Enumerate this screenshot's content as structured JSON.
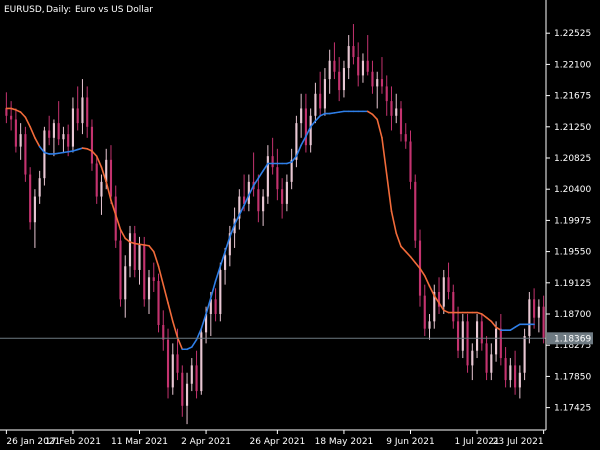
{
  "chart_data": {
    "type": "candlestick",
    "symbol": "EURUSD",
    "timeframe": "Daily",
    "description": "Euro vs US Dollar",
    "current_price": "1.18369",
    "ylim": [
      1.1712,
      1.2295
    ],
    "y_ticks": [
      "1.22525",
      "1.22100",
      "1.21675",
      "1.21250",
      "1.20825",
      "1.20400",
      "1.19975",
      "1.19550",
      "1.19125",
      "1.18700",
      "1.18275",
      "1.17850",
      "1.17425"
    ],
    "x_ticks": [
      "26 Jan 2021",
      "17 Feb 2021",
      "11 Mar 2021",
      "2 Apr 2021",
      "26 Apr 2021",
      "18 May 2021",
      "9 Jun 2021",
      "1 Jul 2021",
      "23 Jul 2021"
    ],
    "candles": [
      [
        1.215,
        1.2172,
        1.213,
        1.214
      ],
      [
        1.214,
        1.216,
        1.212,
        1.2135
      ],
      [
        1.2135,
        1.215,
        1.209,
        1.2098
      ],
      [
        1.2098,
        1.213,
        1.208,
        1.2115
      ],
      [
        1.2115,
        1.2125,
        1.205,
        1.206
      ],
      [
        1.206,
        1.207,
        1.1985,
        1.1995
      ],
      [
        1.1995,
        1.204,
        1.196,
        1.203
      ],
      [
        1.203,
        1.2065,
        1.202,
        1.2055
      ],
      [
        1.2055,
        1.2125,
        1.2045,
        1.212
      ],
      [
        1.212,
        1.214,
        1.21,
        1.211
      ],
      [
        1.211,
        1.2135,
        1.2085,
        1.213
      ],
      [
        1.213,
        1.216,
        1.21,
        1.2108
      ],
      [
        1.2108,
        1.2125,
        1.209,
        1.2115
      ],
      [
        1.2115,
        1.2128,
        1.2085,
        1.2098
      ],
      [
        1.2098,
        1.2165,
        1.209,
        1.215
      ],
      [
        1.215,
        1.218,
        1.212,
        1.213
      ],
      [
        1.213,
        1.219,
        1.2115,
        1.2165
      ],
      [
        1.2165,
        1.218,
        1.211,
        1.2125
      ],
      [
        1.2125,
        1.2135,
        1.2065,
        1.2075
      ],
      [
        1.2075,
        1.2085,
        1.202,
        1.203
      ],
      [
        1.203,
        1.206,
        1.2005,
        1.205
      ],
      [
        1.205,
        1.2095,
        1.204,
        1.208
      ],
      [
        1.208,
        1.21,
        1.202,
        1.203
      ],
      [
        1.203,
        1.2045,
        1.196,
        1.197
      ],
      [
        1.197,
        1.1985,
        1.188,
        1.189
      ],
      [
        1.189,
        1.195,
        1.1865,
        1.1935
      ],
      [
        1.1935,
        1.199,
        1.192,
        1.198
      ],
      [
        1.198,
        1.199,
        1.192,
        1.193
      ],
      [
        1.193,
        1.1975,
        1.191,
        1.1965
      ],
      [
        1.1965,
        1.1975,
        1.188,
        1.189
      ],
      [
        1.189,
        1.193,
        1.187,
        1.192
      ],
      [
        1.192,
        1.194,
        1.19,
        1.1915
      ],
      [
        1.1915,
        1.1925,
        1.1845,
        1.1855
      ],
      [
        1.1855,
        1.1875,
        1.182,
        1.1835
      ],
      [
        1.1835,
        1.185,
        1.1755,
        1.177
      ],
      [
        1.177,
        1.183,
        1.176,
        1.1815
      ],
      [
        1.1815,
        1.185,
        1.178,
        1.179
      ],
      [
        1.179,
        1.18,
        1.173,
        1.1745
      ],
      [
        1.1745,
        1.179,
        1.172,
        1.1775
      ],
      [
        1.1775,
        1.181,
        1.1765,
        1.18
      ],
      [
        1.18,
        1.182,
        1.1755,
        1.1765
      ],
      [
        1.1765,
        1.185,
        1.176,
        1.1845
      ],
      [
        1.1845,
        1.188,
        1.183,
        1.187
      ],
      [
        1.187,
        1.19,
        1.184,
        1.189
      ],
      [
        1.189,
        1.1905,
        1.186,
        1.187
      ],
      [
        1.187,
        1.194,
        1.186,
        1.193
      ],
      [
        1.193,
        1.196,
        1.191,
        1.195
      ],
      [
        1.195,
        1.199,
        1.1935,
        1.198
      ],
      [
        1.198,
        1.2015,
        1.196,
        1.2
      ],
      [
        1.2,
        1.204,
        1.1985,
        1.203
      ],
      [
        1.203,
        1.206,
        1.201,
        1.202
      ],
      [
        1.202,
        1.206,
        1.201,
        1.205
      ],
      [
        1.205,
        1.209,
        1.203,
        1.204
      ],
      [
        1.204,
        1.206,
        1.1995,
        1.201
      ],
      [
        1.201,
        1.204,
        1.199,
        1.203
      ],
      [
        1.203,
        1.21,
        1.202,
        1.2085
      ],
      [
        1.2085,
        1.211,
        1.206,
        1.207
      ],
      [
        1.207,
        1.2095,
        1.2025,
        1.204
      ],
      [
        1.204,
        1.2055,
        1.2,
        1.202
      ],
      [
        1.202,
        1.206,
        1.201,
        1.205
      ],
      [
        1.205,
        1.2095,
        1.204,
        1.208
      ],
      [
        1.208,
        1.214,
        1.207,
        1.213
      ],
      [
        1.213,
        1.217,
        1.211,
        1.215
      ],
      [
        1.215,
        1.217,
        1.209,
        1.21
      ],
      [
        1.21,
        1.215,
        1.209,
        1.214
      ],
      [
        1.214,
        1.2185,
        1.213,
        1.217
      ],
      [
        1.217,
        1.22,
        1.214,
        1.215
      ],
      [
        1.215,
        1.2205,
        1.214,
        1.219
      ],
      [
        1.219,
        1.223,
        1.217,
        1.2215
      ],
      [
        1.2215,
        1.224,
        1.219,
        1.22
      ],
      [
        1.22,
        1.222,
        1.216,
        1.2175
      ],
      [
        1.2175,
        1.2215,
        1.2165,
        1.2205
      ],
      [
        1.2205,
        1.225,
        1.219,
        1.2235
      ],
      [
        1.2235,
        1.2265,
        1.221,
        1.222
      ],
      [
        1.222,
        1.224,
        1.218,
        1.2195
      ],
      [
        1.2195,
        1.2225,
        1.2185,
        1.2215
      ],
      [
        1.2215,
        1.225,
        1.2195,
        1.22
      ],
      [
        1.22,
        1.2215,
        1.217,
        1.218
      ],
      [
        1.218,
        1.22,
        1.215,
        1.219
      ],
      [
        1.219,
        1.222,
        1.217,
        1.218
      ],
      [
        1.218,
        1.2195,
        1.214,
        1.216
      ],
      [
        1.216,
        1.218,
        1.212,
        1.214
      ],
      [
        1.214,
        1.217,
        1.213,
        1.215
      ],
      [
        1.215,
        1.216,
        1.2105,
        1.2115
      ],
      [
        1.2115,
        1.213,
        1.2095,
        1.2105
      ],
      [
        1.2105,
        1.212,
        1.204,
        1.205
      ],
      [
        1.205,
        1.206,
        1.196,
        1.197
      ],
      [
        1.197,
        1.1985,
        1.188,
        1.1895
      ],
      [
        1.1895,
        1.191,
        1.184,
        1.185
      ],
      [
        1.185,
        1.187,
        1.1835,
        1.186
      ],
      [
        1.186,
        1.191,
        1.185,
        1.19
      ],
      [
        1.19,
        1.192,
        1.187,
        1.188
      ],
      [
        1.188,
        1.193,
        1.187,
        1.192
      ],
      [
        1.192,
        1.194,
        1.189,
        1.19
      ],
      [
        1.19,
        1.191,
        1.185,
        1.186
      ],
      [
        1.186,
        1.188,
        1.181,
        1.182
      ],
      [
        1.182,
        1.187,
        1.181,
        1.186
      ],
      [
        1.186,
        1.187,
        1.179,
        1.18
      ],
      [
        1.18,
        1.183,
        1.178,
        1.182
      ],
      [
        1.182,
        1.187,
        1.181,
        1.186
      ],
      [
        1.186,
        1.187,
        1.182,
        1.183
      ],
      [
        1.183,
        1.184,
        1.178,
        1.179
      ],
      [
        1.179,
        1.183,
        1.178,
        1.1815
      ],
      [
        1.1815,
        1.186,
        1.1805,
        1.185
      ],
      [
        1.185,
        1.187,
        1.18,
        1.181
      ],
      [
        1.181,
        1.1825,
        1.177,
        1.178
      ],
      [
        1.178,
        1.181,
        1.177,
        1.18
      ],
      [
        1.18,
        1.182,
        1.176,
        1.177
      ],
      [
        1.177,
        1.18,
        1.1755,
        1.179
      ],
      [
        1.179,
        1.185,
        1.178,
        1.184
      ],
      [
        1.184,
        1.19,
        1.183,
        1.189
      ],
      [
        1.189,
        1.1905,
        1.185,
        1.1865
      ],
      [
        1.1865,
        1.189,
        1.1845,
        1.188
      ],
      [
        1.188,
        1.1895,
        1.183,
        1.1837
      ]
    ],
    "indicator": {
      "name": "Trend MA",
      "up_color": "#2f7fe8",
      "down_color": "#f26b3a",
      "values": [
        1.215,
        1.215,
        1.2148,
        1.2145,
        1.2138,
        1.2125,
        1.211,
        1.2098,
        1.209,
        1.2088,
        1.2088,
        1.2089,
        1.209,
        1.2091,
        1.2092,
        1.2094,
        1.2096,
        1.2095,
        1.2092,
        1.2085,
        1.207,
        1.205,
        1.2025,
        1.2005,
        1.1985,
        1.1973,
        1.1968,
        1.1966,
        1.1965,
        1.1964,
        1.1963,
        1.1955,
        1.1935,
        1.191,
        1.1885,
        1.186,
        1.1838,
        1.1822,
        1.1822,
        1.1825,
        1.1835,
        1.185,
        1.187,
        1.1892,
        1.1915,
        1.1935,
        1.1955,
        1.1975,
        1.1992,
        1.2005,
        1.2018,
        1.2032,
        1.2045,
        1.2055,
        1.2065,
        1.2075,
        1.2075,
        1.2075,
        1.2075,
        1.2075,
        1.2077,
        1.2085,
        1.21,
        1.2112,
        1.2125,
        1.2133,
        1.214,
        1.2143,
        1.2143,
        1.2144,
        1.2145,
        1.2146,
        1.2146,
        1.2146,
        1.2146,
        1.2146,
        1.2146,
        1.2142,
        1.2135,
        1.211,
        1.206,
        1.201,
        1.198,
        1.1962,
        1.1955,
        1.1948,
        1.194,
        1.1932,
        1.1922,
        1.1908,
        1.1895,
        1.1885,
        1.1875,
        1.1872,
        1.1872,
        1.1872,
        1.1872,
        1.1872,
        1.1872,
        1.1872,
        1.187,
        1.1865,
        1.186,
        1.1852,
        1.1848,
        1.1848,
        1.1848,
        1.1852,
        1.1856,
        1.1856,
        1.1856,
        1.1856
      ],
      "trend": [
        "down",
        "down",
        "down",
        "down",
        "down",
        "down",
        "down",
        "down",
        "up",
        "up",
        "up",
        "up",
        "up",
        "up",
        "up",
        "up",
        "up",
        "down",
        "down",
        "down",
        "down",
        "down",
        "down",
        "down",
        "down",
        "down",
        "down",
        "down",
        "down",
        "down",
        "down",
        "down",
        "down",
        "down",
        "down",
        "down",
        "down",
        "down",
        "up",
        "up",
        "up",
        "up",
        "up",
        "up",
        "up",
        "up",
        "up",
        "up",
        "up",
        "up",
        "up",
        "up",
        "up",
        "up",
        "up",
        "up",
        "up",
        "up",
        "up",
        "up",
        "up",
        "up",
        "up",
        "up",
        "up",
        "up",
        "up",
        "up",
        "up",
        "up",
        "up",
        "up",
        "up",
        "up",
        "up",
        "up",
        "up",
        "down",
        "down",
        "down",
        "down",
        "down",
        "down",
        "down",
        "down",
        "down",
        "down",
        "down",
        "down",
        "down",
        "down",
        "down",
        "down",
        "down",
        "down",
        "down",
        "down",
        "down",
        "down",
        "down",
        "down",
        "down",
        "down",
        "down",
        "down",
        "up",
        "up",
        "up",
        "up",
        "up",
        "up",
        "up"
      ]
    },
    "candle_colors": {
      "up": "#e8c7d3",
      "down": "#c4336f",
      "wick": "#c4336f"
    },
    "colors": {
      "background": "#000000",
      "axis": "#ffffff",
      "price_line": "#6e7a82",
      "price_tag_bg": "#6e7a82",
      "price_tag_text": "#ffffff"
    }
  }
}
